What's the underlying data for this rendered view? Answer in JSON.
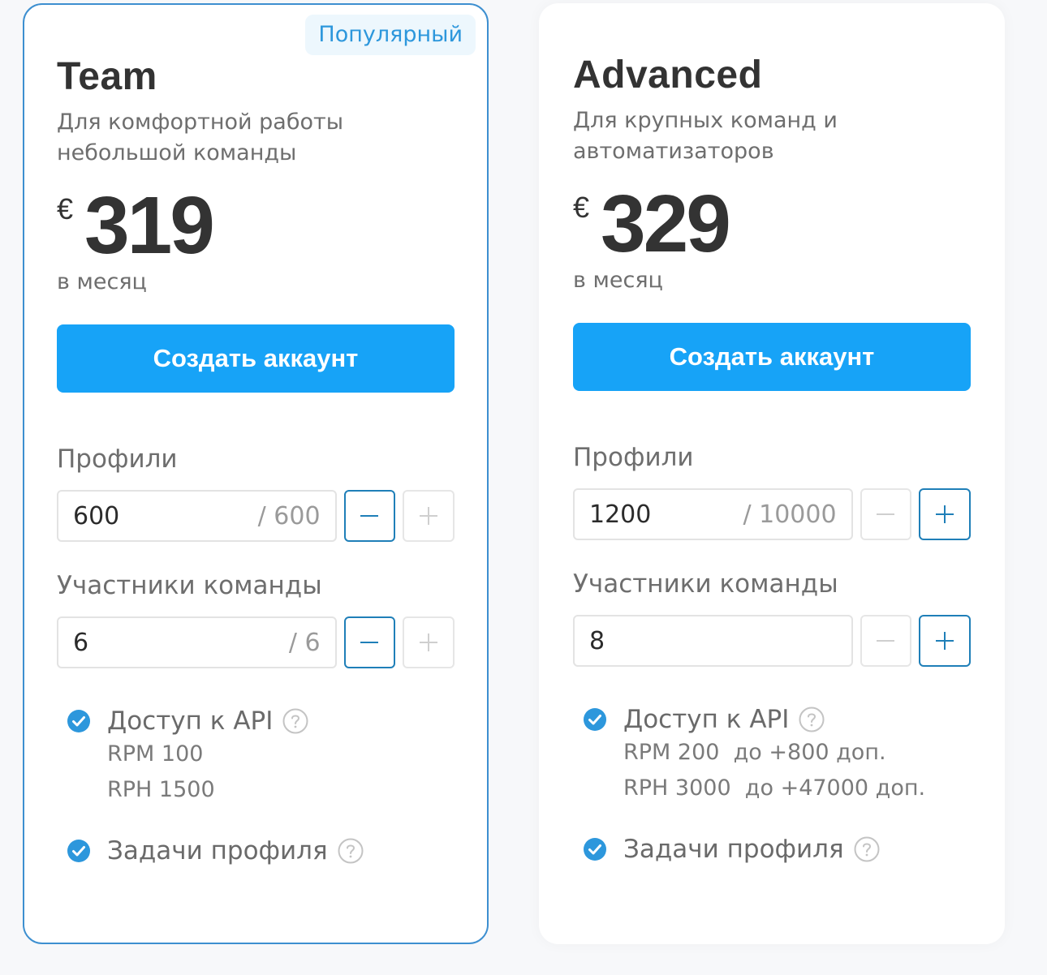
{
  "colors": {
    "accent": "#17a3f7",
    "border_active": "#3d8fd0",
    "badge_bg": "#edf7fd",
    "badge_text": "#2d97dc",
    "check": "#2d97dc"
  },
  "plans": [
    {
      "badge": "Популярный",
      "name": "Team",
      "description": "Для комфортной работы небольшой команды",
      "currency": "€",
      "price": "319",
      "period": "в месяц",
      "cta_label": "Создать аккаунт",
      "profiles_label": "Профили",
      "profiles_value": "600",
      "profiles_max": "/ 600",
      "members_label": "Участники команды",
      "members_value": "6",
      "members_max": "/ 6",
      "steppers": {
        "profiles_minus": "active",
        "profiles_plus": "disabled",
        "members_minus": "active",
        "members_plus": "disabled"
      },
      "features": {
        "api_title": "Доступ к API",
        "api_line1": "RPM 100",
        "api_line2": "RPH 1500",
        "tasks_title": "Задачи профиля"
      }
    },
    {
      "name": "Advanced",
      "description": "Для крупных команд и автоматизаторов",
      "currency": "€",
      "price": "329",
      "period": "в месяц",
      "cta_label": "Создать аккаунт",
      "profiles_label": "Профили",
      "profiles_value": "1200",
      "profiles_max": "/ 10000",
      "members_label": "Участники команды",
      "members_value": "8",
      "members_max": "",
      "steppers": {
        "profiles_minus": "disabled",
        "profiles_plus": "active",
        "members_minus": "disabled",
        "members_plus": "active"
      },
      "features": {
        "api_title": "Доступ к API",
        "api_line1": "RPM 200  до +800 доп.",
        "api_line2": "RPH 3000  до +47000 доп.",
        "tasks_title": "Задачи профиля"
      }
    }
  ]
}
